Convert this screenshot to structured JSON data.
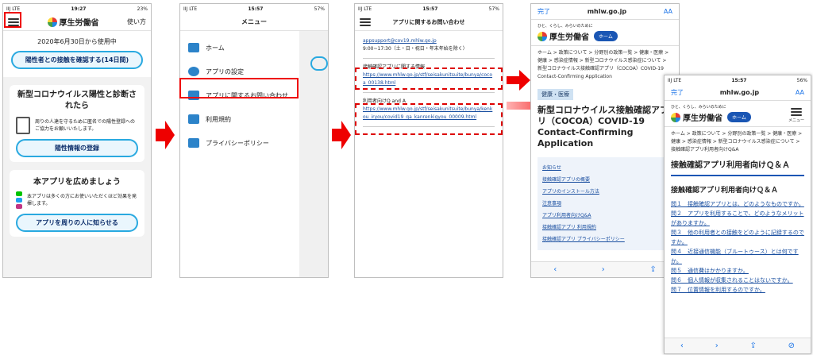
{
  "screen1": {
    "status": {
      "carrier": "IIJ  LTE",
      "time": "19:27",
      "battery": "23%"
    },
    "header": {
      "title": "厚生労働省",
      "help": "使い方"
    },
    "since": "2020年6月30日から使用中",
    "check_button": "陽性者との接触を確認する(14日間)",
    "positive_card": {
      "title": "新型コロナウイルス陽性と診断されたら",
      "text": "周りの人達を守るために匿名での陽性登録へのご協力をお願いいたします。",
      "button": "陽性情報の登録"
    },
    "share_card": {
      "title": "本アプリを広めましょう",
      "text": "本アプリは多くの方にお使いいただくほど効果を発揮します。",
      "button": "アプリを周りの人に知らせる"
    }
  },
  "screen2": {
    "status": {
      "carrier": "IIJ  LTE",
      "time": "15:57",
      "battery": "57%"
    },
    "title": "メニュー",
    "items": [
      {
        "label": "ホーム",
        "icon": "home-icon"
      },
      {
        "label": "アプリの設定",
        "icon": "gear-icon"
      },
      {
        "label": "アプリに関するお問い合わせ",
        "icon": "mail-icon"
      },
      {
        "label": "利用規約",
        "icon": "document-icon"
      },
      {
        "label": "プライバシーポリシー",
        "icon": "document-icon"
      }
    ]
  },
  "screen3": {
    "status": {
      "carrier": "IIJ  LTE",
      "time": "15:57",
      "battery": "57%"
    },
    "title": "アプリに関するお問い合わせ",
    "email": "appsupport@cov19.mhlw.go.jp",
    "hours": "9:00~17:30（土・日・祝日・年末年始を除く）",
    "section1": {
      "label": "接触確認アプリに関する情報",
      "link": "https://www.mhlw.go.jp/stf/seisakunitsuite/bunya/cocoa_00138.html"
    },
    "section2": {
      "label": "利用者向けQ and A",
      "link": "https://www.mhlw.go.jp/stf/seisakunitsuite/bunya/kenkou_iryou/covid19_qa_kanrenkigyou_00009.html"
    }
  },
  "screen4": {
    "status": {
      "carrier": "",
      "time": "",
      "battery": ""
    },
    "done": "完了",
    "domain": "mhlw.go.jp",
    "aa": "AA",
    "tagline": "ひと、くらし、みらいのために",
    "logo": "厚生労働省",
    "home_btn": "ホーム",
    "crumb": "ホーム > 政策について > 分野別の政策一覧 > 健康・医療 > 健康 > 感染症情報 > 新型コロナウイルス感染症について > 新型コロナウイルス接触確認アプリ（COCOA）COVID-19 Contact-Confirming Application",
    "tag": "健康・医療",
    "heading": "新型コロナウイルス接触確認アプリ（COCOA）COVID-19 Contact-Confirming Application",
    "links": [
      "お知らせ",
      "接触確認アプリの概要",
      "アプリのインストール方法",
      "注意事項",
      "アプリ利用者向けQ&A",
      "接触確認アプリ 利用規約",
      "接触確認アプリ プライバシーポリシー"
    ]
  },
  "screen5": {
    "status": {
      "carrier": "IIJ  LTE",
      "time": "15:57",
      "battery": "56%"
    },
    "done": "完了",
    "domain": "mhlw.go.jp",
    "aa": "AA",
    "tagline": "ひと、くらし、みらいのために",
    "logo": "厚生労働省",
    "home_btn": "ホーム",
    "menu": "メニュー",
    "crumb": "ホーム > 政策について > 分野別の政策一覧 > 健康・医療 > 健康 > 感染症情報 > 新型コロナウイルス感染症について > 接触確認アプリ利用者向けQ&A",
    "heading": "接触確認アプリ利用者向けＱ＆Ａ",
    "subheading": "接触確認アプリ利用者向けＱ＆Ａ",
    "questions": [
      "問１　接触確認アプリとは、どのようなものですか。",
      "問２　アプリを利用することで、どのようなメリットがありますか。",
      "問３　他の利用者との接触をどのように記録するのですか。",
      "問４　近接通信機能（ブルートゥース）とは何ですか。",
      "問５　通信費はかかりますか。",
      "問６　個人情報が収集されることはないですか。",
      "問７　位置情報を利用するのですか。"
    ]
  }
}
